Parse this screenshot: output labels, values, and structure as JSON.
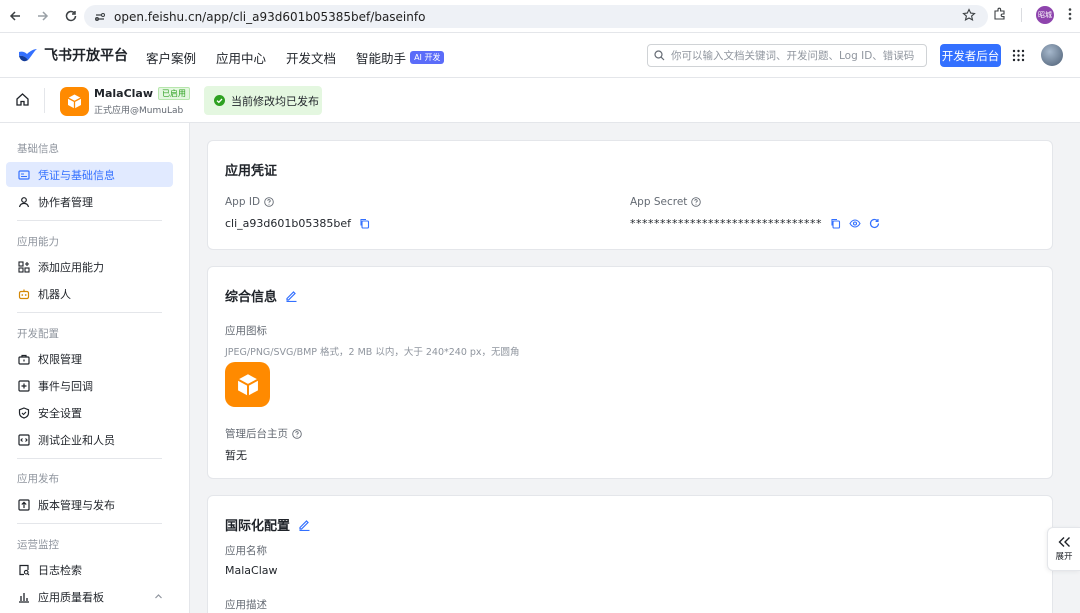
{
  "browser": {
    "url": "open.feishu.cn/app/cli_a93d601b05385bef/baseinfo",
    "profile_label": "昭城"
  },
  "topnav": {
    "brand": "飞书开放平台",
    "links": [
      "客户案例",
      "应用中心",
      "开发文档",
      "智能助手"
    ],
    "ai_badge": "AI 开发",
    "search_placeholder": "你可以输入文档关键词、开发问题、Log ID、错误码",
    "dev_console": "开发者后台"
  },
  "app": {
    "name": "MalaClaw",
    "status": "已启用",
    "subtitle": "正式应用@MumuLab",
    "publish_status": "当前修改均已发布"
  },
  "sidebar": {
    "sections": [
      {
        "title": "基础信息",
        "items": [
          "凭证与基础信息",
          "协作者管理"
        ]
      },
      {
        "title": "应用能力",
        "items": [
          "添加应用能力",
          "机器人"
        ]
      },
      {
        "title": "开发配置",
        "items": [
          "权限管理",
          "事件与回调",
          "安全设置",
          "测试企业和人员"
        ]
      },
      {
        "title": "应用发布",
        "items": [
          "版本管理与发布"
        ]
      },
      {
        "title": "运营监控",
        "items": [
          "日志检索",
          "应用质量看板"
        ]
      }
    ]
  },
  "credentials": {
    "title": "应用凭证",
    "app_id_label": "App ID",
    "app_id": "cli_a93d601b05385bef",
    "app_secret_label": "App Secret",
    "app_secret": "********************************"
  },
  "general": {
    "title": "综合信息",
    "icon_label": "应用图标",
    "icon_hint": "JPEG/PNG/SVG/BMP 格式，2 MB 以内，大于 240*240 px，无圆角",
    "admin_home_label": "管理后台主页",
    "admin_home_value": "暂无"
  },
  "i18n": {
    "title": "国际化配置",
    "name_label": "应用名称",
    "name_value": "MalaClaw",
    "desc_label": "应用描述"
  },
  "expand_label": "展开",
  "colors": {
    "accent": "#3370ff",
    "app_orange": "#ff8a00",
    "success": "#2ea121"
  }
}
